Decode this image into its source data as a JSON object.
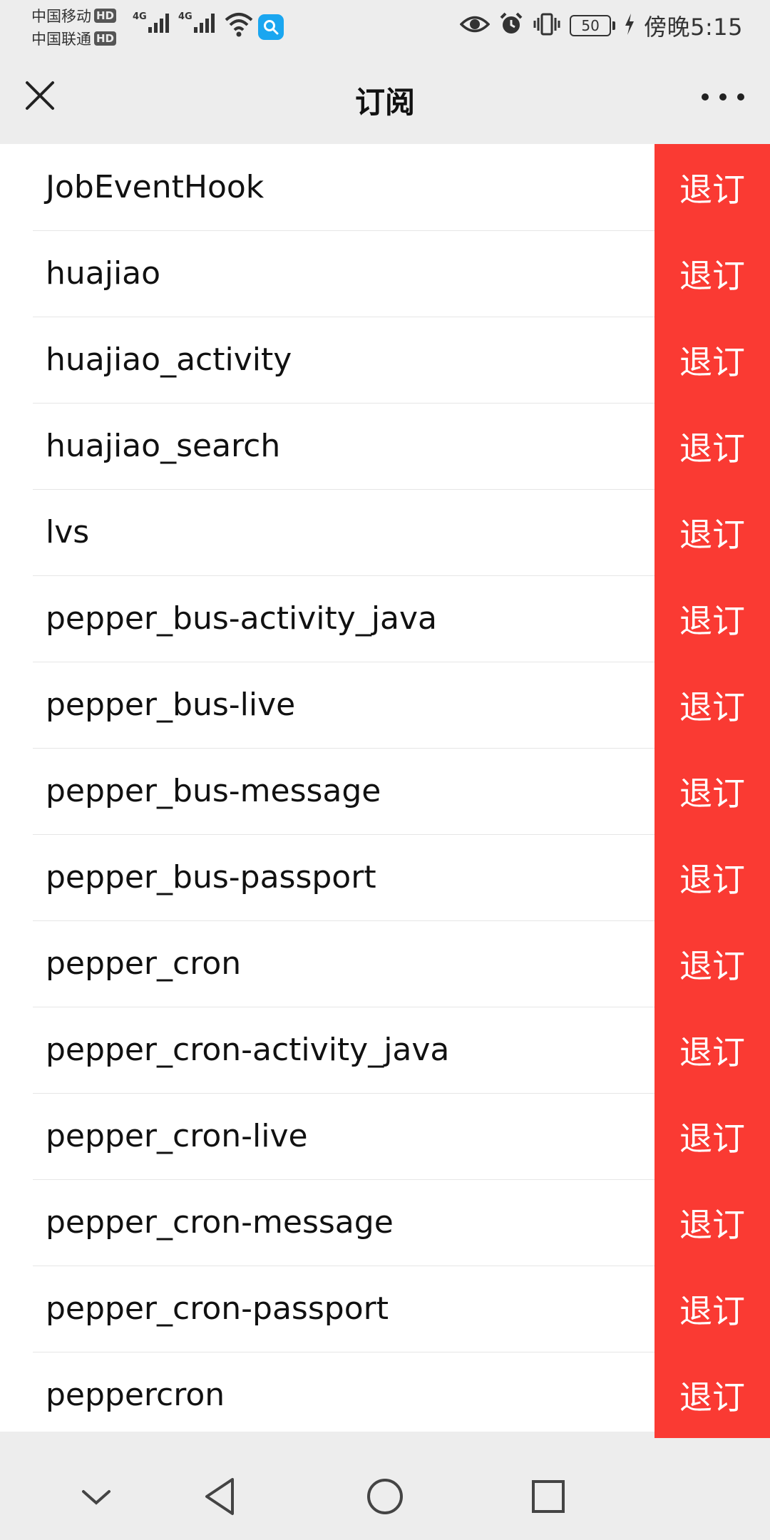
{
  "status_bar": {
    "carrier_1": "中国移动",
    "carrier_2": "中国联通",
    "hd_badge": "HD",
    "network_1": "4G",
    "network_2": "4G",
    "battery": "50",
    "time": "傍晚5:15"
  },
  "header": {
    "title": "订阅"
  },
  "subscriptions": {
    "unsubscribe_label": "退订",
    "items": [
      "JobEventHook",
      "huajiao",
      "huajiao_activity",
      "huajiao_search",
      "lvs",
      "pepper_bus-activity_java",
      "pepper_bus-live",
      "pepper_bus-message",
      "pepper_bus-passport",
      "pepper_cron",
      "pepper_cron-activity_java",
      "pepper_cron-live",
      "pepper_cron-message",
      "pepper_cron-passport",
      "peppercron"
    ]
  },
  "colors": {
    "unsubscribe_bg": "#fa3a33",
    "page_bg": "#ededed",
    "list_bg": "#ffffff"
  },
  "icons": [
    "close-icon",
    "more-icon",
    "eye-icon",
    "alarm-icon",
    "vibrate-icon",
    "charging-icon",
    "wifi-icon",
    "search-app-icon",
    "nav-collapse-icon",
    "nav-back-icon",
    "nav-home-icon",
    "nav-recents-icon"
  ]
}
